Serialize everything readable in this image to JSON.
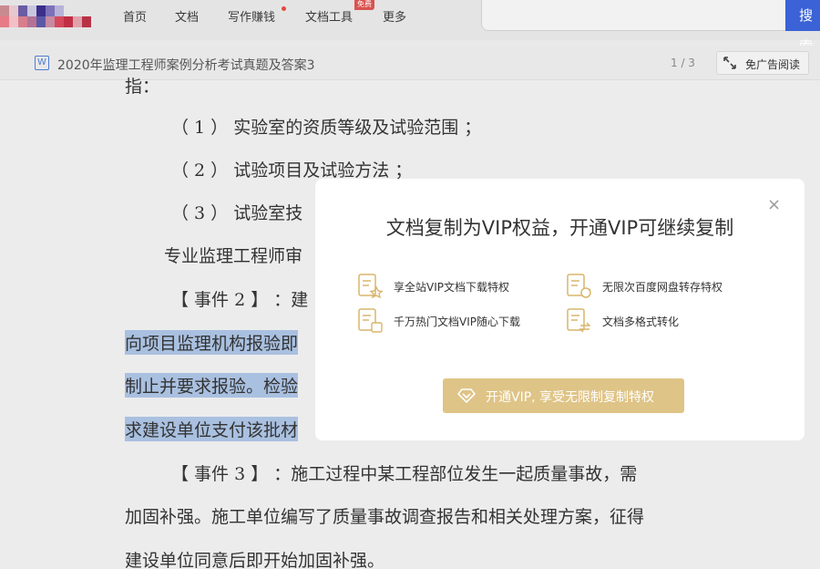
{
  "nav": {
    "items": [
      "首页",
      "文档",
      "写作赚钱",
      "文档工具",
      "更多"
    ],
    "tool_badge": "免费",
    "search_button": "搜索"
  },
  "docbar": {
    "doc_title": "2020年监理工程师案例分析考试真题及答案3",
    "file_icon": "W",
    "page_indicator": "1 / 3",
    "adfree_label": "免广告阅读"
  },
  "document": {
    "lines": [
      "指：",
      "（ 1 ） 实验室的资质等级及试验范围 ；",
      "（ 2 ） 试验项目及试验方法 ；",
      "（ 3 ） 试验室技",
      "专业监理工程师审",
      "【 事件 2 】 ：建",
      "向项目监理机构报验即",
      "制止并要求报验。检验",
      "求建设单位支付该批材",
      "【 事件 3 】 ：施工过程中某工程部位发生一起质量事故，需",
      "加固补强。施工单位编写了质量事故调查报告和相关处理方案，征得",
      "建设单位同意后即开始加固补强。"
    ]
  },
  "modal": {
    "title": "文档复制为VIP权益，开通VIP可继续复制",
    "benefits": [
      "享全站VIP文档下载特权",
      "无限次百度网盘转存特权",
      "千万热门文档VIP随心下载",
      "文档多格式转化"
    ],
    "cta_label": "开通VIP, 享受无限制复制特权",
    "close_symbol": "×"
  },
  "colors": {
    "accent_blue": "#3b62d6",
    "vip_gold": "#dfc487",
    "highlight": "#a9c0e0",
    "badge_red": "#d9534f"
  }
}
